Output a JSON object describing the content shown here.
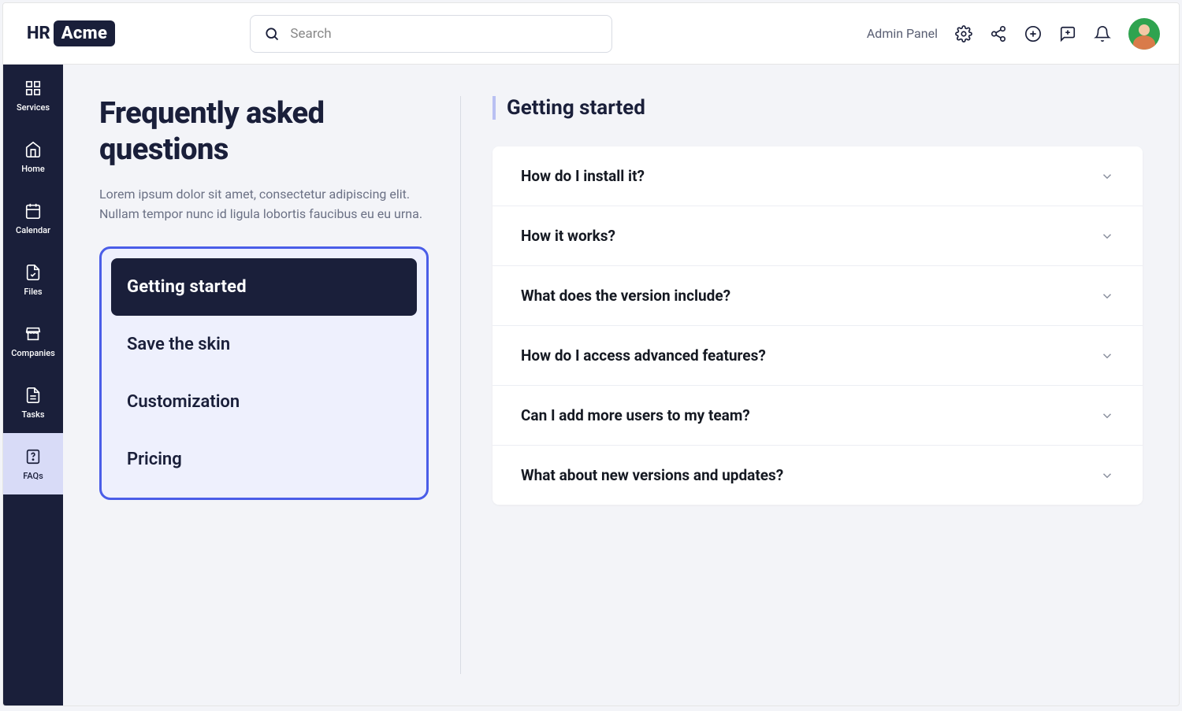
{
  "brand": {
    "part1": "HR",
    "part2": "Acme"
  },
  "search": {
    "placeholder": "Search"
  },
  "admin_link": "Admin Panel",
  "sidebar": [
    {
      "label": "Services"
    },
    {
      "label": "Home"
    },
    {
      "label": "Calendar"
    },
    {
      "label": "Files"
    },
    {
      "label": "Companies"
    },
    {
      "label": "Tasks"
    },
    {
      "label": "FAQs"
    }
  ],
  "faq": {
    "title": "Frequently asked questions",
    "description": "Lorem ipsum dolor sit amet, consectetur adipiscing elit. Nullam tempor nunc id ligula lobortis faucibus eu eu urna.",
    "categories": [
      "Getting started",
      "Save the skin",
      "Customization",
      "Pricing"
    ],
    "section_name": "Getting started",
    "questions": [
      "How do I install it?",
      "How it works?",
      "What does the version include?",
      "How do I access advanced features?",
      "Can I add more users to my team?",
      "What about new versions and updates?"
    ]
  }
}
